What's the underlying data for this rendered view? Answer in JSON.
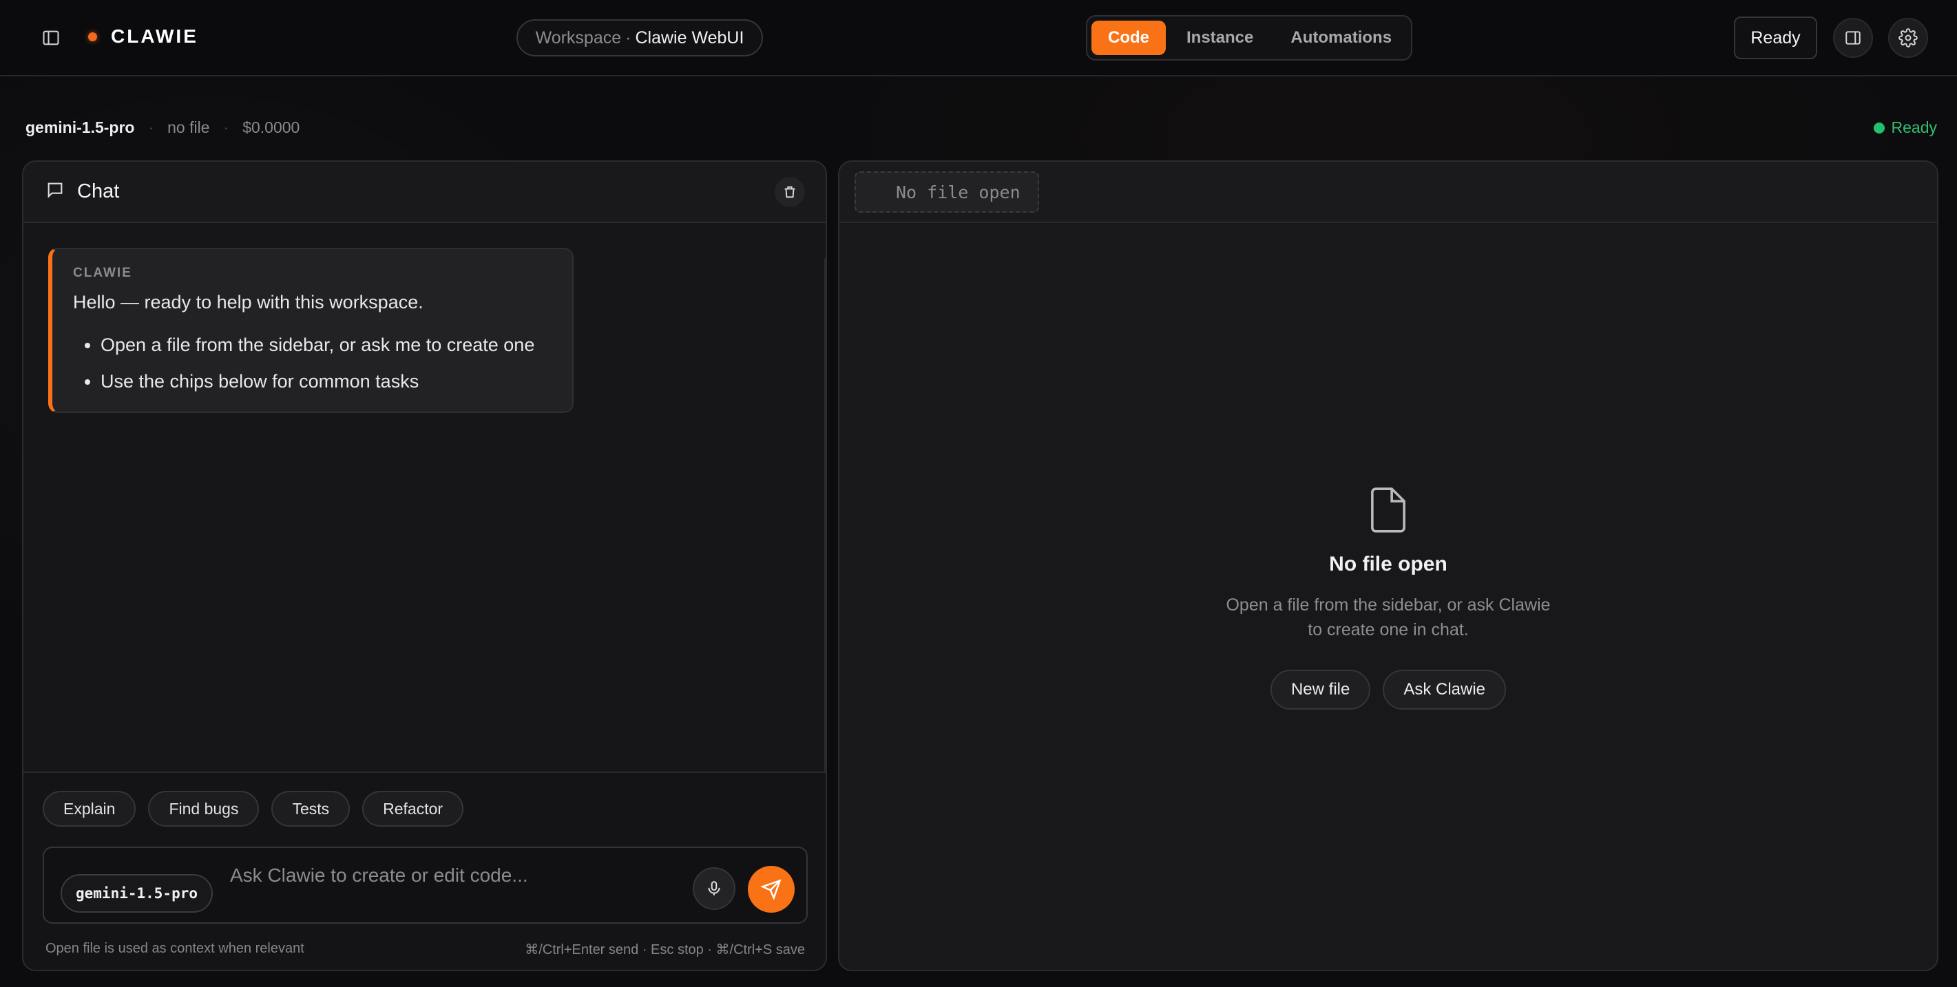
{
  "header": {
    "brand": "CLAWIE",
    "workspace_label": "Workspace",
    "workspace_separator": "·",
    "workspace_name": "Clawie WebUI",
    "tabs": [
      {
        "label": "Code",
        "active": true
      },
      {
        "label": "Instance",
        "active": false
      },
      {
        "label": "Automations",
        "active": false
      }
    ],
    "ready_label": "Ready"
  },
  "status": {
    "model": "gemini-1.5-pro",
    "separator": "·",
    "file": "no file",
    "cost": "$0.0000",
    "state": "Ready"
  },
  "chat": {
    "title": "Chat",
    "message": {
      "sender": "CLAWIE",
      "text": "Hello — ready to help with this workspace.",
      "bullets": [
        "Open a file from the sidebar, or ask me to create one",
        "Use the chips below for common tasks"
      ]
    },
    "chips": [
      "Explain",
      "Find bugs",
      "Tests",
      "Refactor"
    ],
    "composer": {
      "model_badge": "gemini-1.5-pro",
      "placeholder": "Ask Clawie to create or edit code..."
    },
    "hint_left": "Open file is used as context when relevant",
    "hint_right": "⌘/Ctrl+Enter send · Esc stop · ⌘/Ctrl+S save"
  },
  "editor": {
    "tab_label": "No file open",
    "empty_title": "No file open",
    "empty_desc_line1": "Open a file from the sidebar, or ask Clawie",
    "empty_desc_line2": "to create one in chat.",
    "new_file_label": "New file",
    "ask_label": "Ask Clawie"
  },
  "colors": {
    "accent": "#f97316",
    "status_green": "#22c06a",
    "background": "#0c0c0e"
  }
}
